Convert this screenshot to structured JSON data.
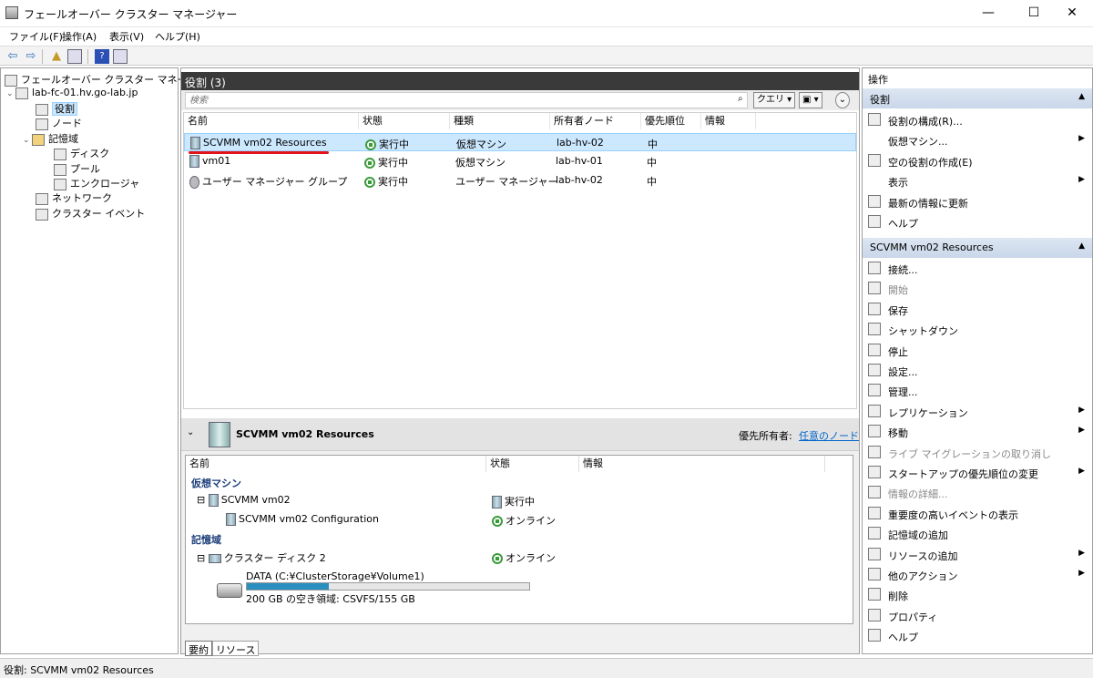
{
  "window": {
    "title": "フェールオーバー クラスター マネージャー",
    "min": "—",
    "max": "☐",
    "close": "✕"
  },
  "menu": [
    "ファイル(F)",
    "操作(A)",
    "表示(V)",
    "ヘルプ(H)"
  ],
  "tree": {
    "root": "フェールオーバー クラスター マネージャー",
    "cluster": "lab-fc-01.hv.go-lab.jp",
    "roles": "役割",
    "nodes": "ノード",
    "storage": "記憶域",
    "disks": "ディスク",
    "pools": "プール",
    "enclosures": "エンクロージャ",
    "networks": "ネットワーク",
    "events": "クラスター イベント"
  },
  "roles": {
    "header": "役割 (3)",
    "search_placeholder": "検索",
    "query_label": "クエリ",
    "columns": [
      "名前",
      "状態",
      "種類",
      "所有者ノード",
      "優先順位",
      "情報"
    ],
    "rows": [
      {
        "name": "SCVMM vm02 Resources",
        "state": "実行中",
        "type": "仮想マシン",
        "owner": "lab-hv-02",
        "priority": "中",
        "info": ""
      },
      {
        "name": "vm01",
        "state": "実行中",
        "type": "仮想マシン",
        "owner": "lab-hv-01",
        "priority": "中",
        "info": ""
      },
      {
        "name": "ユーザー マネージャー グループ",
        "state": "実行中",
        "type": "ユーザー マネージャー",
        "owner": "lab-hv-02",
        "priority": "中",
        "info": ""
      }
    ]
  },
  "detail": {
    "title": "SCVMM vm02 Resources",
    "pref_owner_label": "優先所有者:",
    "pref_owner_link": "任意のノード",
    "columns": [
      "名前",
      "状態",
      "情報"
    ],
    "vm_group": "仮想マシン",
    "vm_name": "SCVMM vm02",
    "vm_state": "実行中",
    "vm_config": "SCVMM vm02 Configuration",
    "vm_config_state": "オンライン",
    "storage_group": "記憶域",
    "disk_name": "クラスター ディスク 2",
    "disk_state": "オンライン",
    "volume_label": "DATA (C:¥ClusterStorage¥Volume1)",
    "volume_free": "200 GB の空き領域: CSVFS/155 GB",
    "volume_fill_pct": 29,
    "tabs": [
      "要約",
      "リソース"
    ]
  },
  "actions": {
    "title": "操作",
    "sec1": "役割",
    "items1": [
      {
        "label": "役割の構成(R)...",
        "arrow": false,
        "icon": "configure-role-icon",
        "dis": false
      },
      {
        "label": "仮想マシン...",
        "arrow": true,
        "icon": "",
        "dis": false
      },
      {
        "label": "空の役割の作成(E)",
        "arrow": false,
        "icon": "empty-role-icon",
        "dis": false
      },
      {
        "label": "表示",
        "arrow": true,
        "icon": "",
        "dis": false
      },
      {
        "label": "最新の情報に更新",
        "arrow": false,
        "icon": "refresh-icon",
        "dis": false
      },
      {
        "label": "ヘルプ",
        "arrow": false,
        "icon": "help-icon",
        "dis": false
      }
    ],
    "sec2": "SCVMM vm02 Resources",
    "items2": [
      {
        "label": "接続...",
        "arrow": false,
        "icon": "connect-icon",
        "dis": false
      },
      {
        "label": "開始",
        "arrow": false,
        "icon": "start-icon",
        "dis": true
      },
      {
        "label": "保存",
        "arrow": false,
        "icon": "save-icon",
        "dis": false
      },
      {
        "label": "シャットダウン",
        "arrow": false,
        "icon": "shutdown-icon",
        "dis": false
      },
      {
        "label": "停止",
        "arrow": false,
        "icon": "stop-icon",
        "dis": false
      },
      {
        "label": "設定...",
        "arrow": false,
        "icon": "settings-icon",
        "dis": false
      },
      {
        "label": "管理...",
        "arrow": false,
        "icon": "manage-icon",
        "dis": false
      },
      {
        "label": "レプリケーション",
        "arrow": true,
        "icon": "replication-icon",
        "dis": false
      },
      {
        "label": "移動",
        "arrow": true,
        "icon": "move-icon",
        "dis": false
      },
      {
        "label": "ライブ マイグレーションの取り消し",
        "arrow": false,
        "icon": "cancel-migration-icon",
        "dis": true
      },
      {
        "label": "スタートアップの優先順位の変更",
        "arrow": true,
        "icon": "priority-icon",
        "dis": false
      },
      {
        "label": "情報の詳細...",
        "arrow": false,
        "icon": "info-details-icon",
        "dis": true
      },
      {
        "label": "重要度の高いイベントの表示",
        "arrow": false,
        "icon": "events-icon",
        "dis": false
      },
      {
        "label": "記憶域の追加",
        "arrow": false,
        "icon": "add-storage-icon",
        "dis": false
      },
      {
        "label": "リソースの追加",
        "arrow": true,
        "icon": "add-resource-icon",
        "dis": false
      },
      {
        "label": "他のアクション",
        "arrow": true,
        "icon": "more-actions-icon",
        "dis": false
      },
      {
        "label": "削除",
        "arrow": false,
        "icon": "delete-icon",
        "dis": false
      },
      {
        "label": "プロパティ",
        "arrow": false,
        "icon": "properties-icon",
        "dis": false
      },
      {
        "label": "ヘルプ",
        "arrow": false,
        "icon": "help-icon",
        "dis": false
      }
    ]
  },
  "status": "役割: SCVMM vm02 Resources"
}
